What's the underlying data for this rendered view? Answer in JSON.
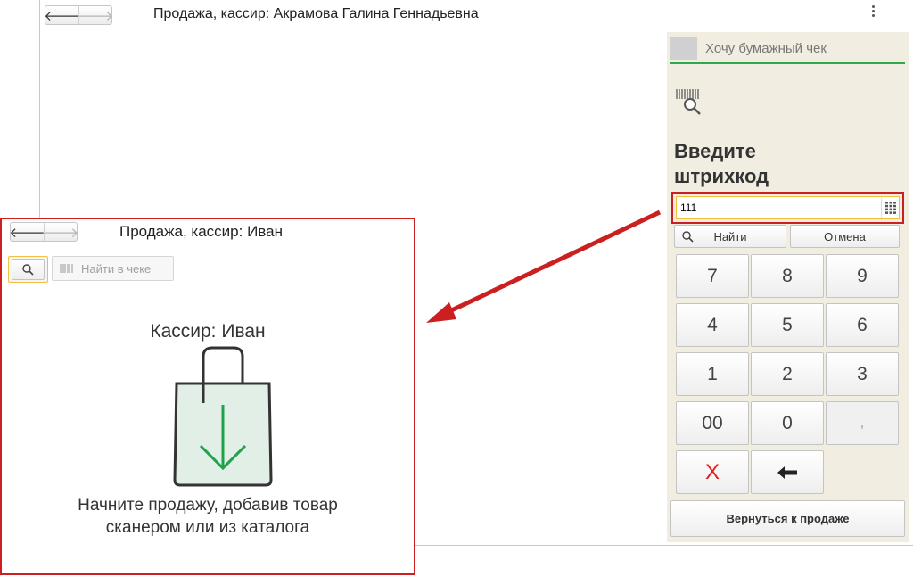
{
  "main_window": {
    "title": "Продажа, кассир: Акрамова Галина Геннадьевна",
    "back_icon": "arrow-left-icon",
    "forward_icon": "arrow-right-icon",
    "menu_icon": "more-vertical-icon"
  },
  "panel": {
    "paper_receipt_label": "Хочу бумажный чек",
    "prompt_line1": "Введите",
    "prompt_line2": "штрихкод",
    "barcode_value": "111",
    "find_label": "Найти",
    "cancel_label": "Отмена",
    "keys": [
      "7",
      "8",
      "9",
      "4",
      "5",
      "6",
      "1",
      "2",
      "3",
      "00",
      "0",
      ","
    ],
    "clear_key": "X",
    "backspace_icon": "backspace-arrow-icon",
    "return_label": "Вернуться к продаже"
  },
  "inset": {
    "title": "Продажа, кассир: Иван",
    "search_icon": "search-icon",
    "find_in_receipt_label": "Найти в чеке",
    "cashier_label": "Кассир: Иван",
    "hint_line1": "Начните продажу, добавив товар",
    "hint_line2": "сканером или из каталога"
  },
  "colors": {
    "highlight_red": "#cc1f1f",
    "panel_bg": "#f1ede1",
    "accent_green": "#2fa84f",
    "focus_yellow": "#f0c040"
  }
}
